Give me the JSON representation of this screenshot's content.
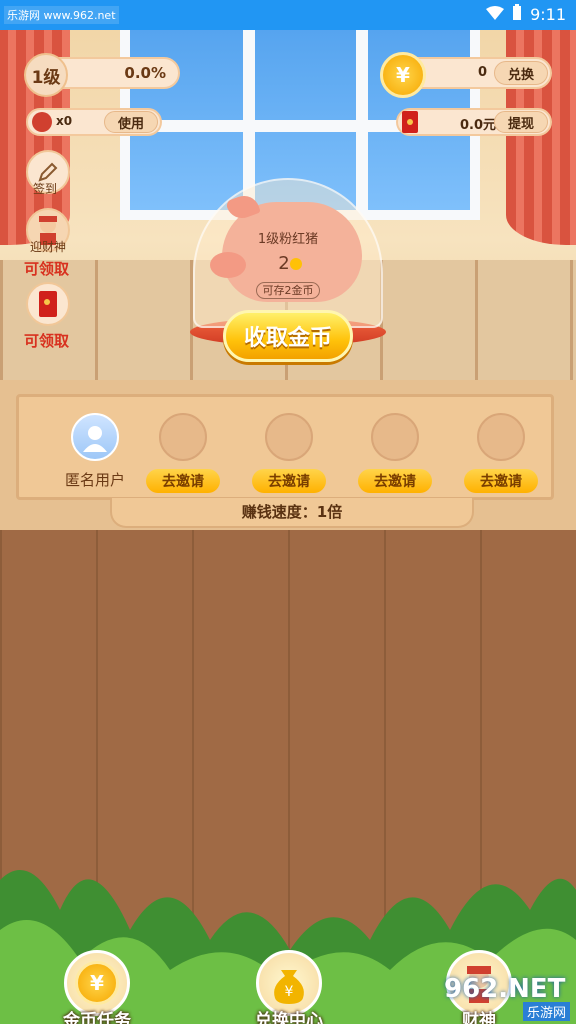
{
  "statusbar": {
    "watermark": "乐游网 www.962.net",
    "time": "9:11"
  },
  "level": {
    "badge": "1级",
    "percent": "0.0%"
  },
  "caishen": {
    "count": "x0",
    "use_label": "使用"
  },
  "coins": {
    "count": "0",
    "exchange_label": "兑换"
  },
  "cash": {
    "amount": "0.0元",
    "withdraw_label": "提现"
  },
  "side": {
    "checkin_label": "签到",
    "caishen_label": "迎财神",
    "caishen_status": "可领取",
    "redpack_status": "可领取"
  },
  "piggy": {
    "title": "1级粉红猪",
    "coins": "2",
    "capacity": "可存2金币",
    "collect_label": "收取金币"
  },
  "invite": {
    "slots": [
      {
        "name": "匿名用户",
        "type": "user"
      },
      {
        "button": "去邀请",
        "type": "invite"
      },
      {
        "button": "去邀请",
        "type": "invite"
      },
      {
        "button": "去邀请",
        "type": "invite"
      },
      {
        "button": "去邀请",
        "type": "invite"
      }
    ],
    "speed": "赚钱速度：1倍"
  },
  "nav": [
    {
      "label": "金币任务",
      "icon": "coin-icon"
    },
    {
      "label": "兑换中心",
      "icon": "money-bag-icon"
    },
    {
      "label": "财神",
      "icon": "caishen-icon"
    }
  ],
  "brand_watermark": {
    "big": "962.NET",
    "small": "乐游网"
  },
  "colors": {
    "statusbar": "#2196f3",
    "accent_gold": "#ffc20a",
    "accent_red": "#d8311f"
  }
}
